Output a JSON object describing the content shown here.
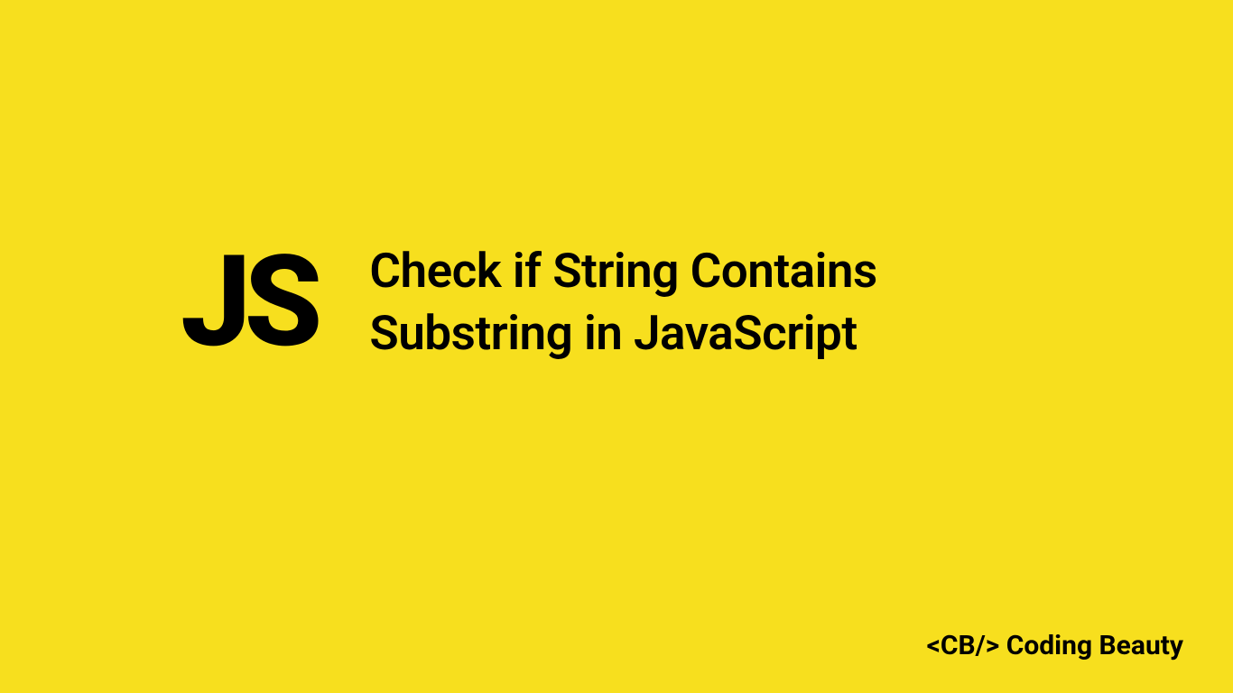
{
  "logo": {
    "text": "JS"
  },
  "title": {
    "line1": "Check if String Contains",
    "line2": "Substring in JavaScript"
  },
  "brand": {
    "tag": "<CB/>",
    "name": "Coding Beauty"
  },
  "colors": {
    "background": "#F7DF1E",
    "text": "#000000"
  }
}
